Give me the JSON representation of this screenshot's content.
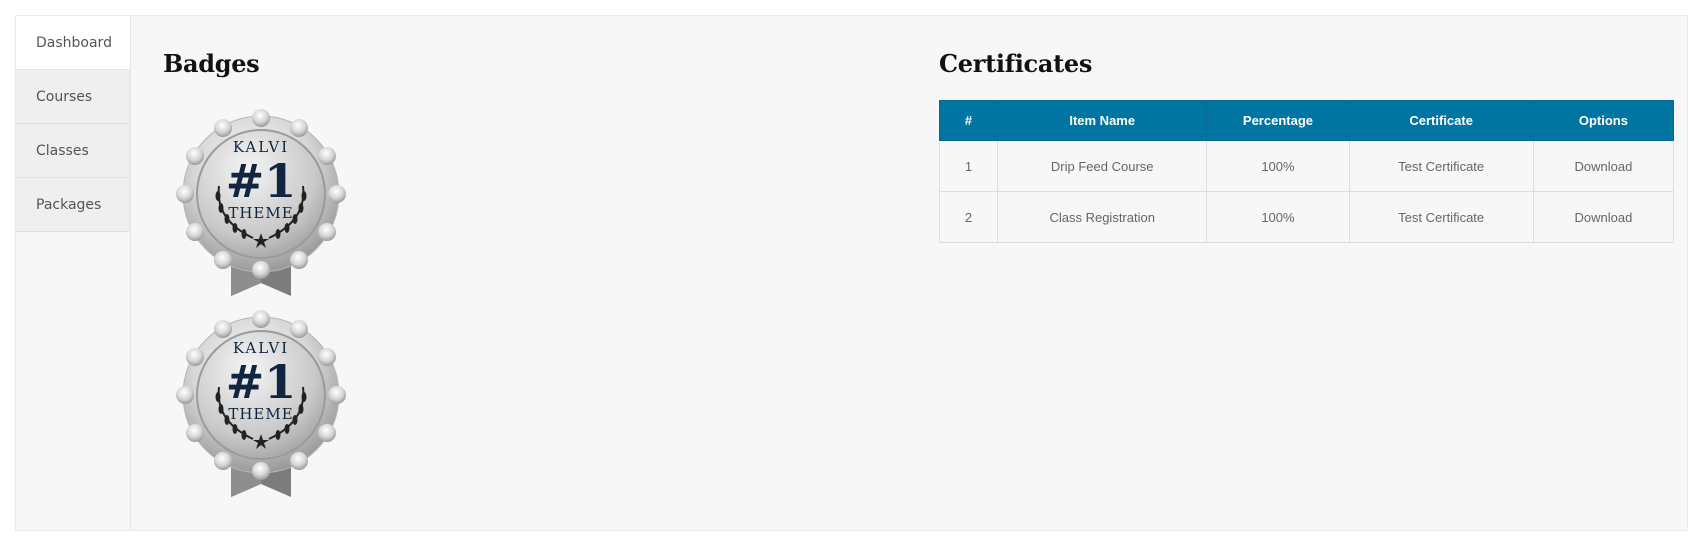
{
  "sidebar": {
    "items": [
      {
        "label": "Dashboard",
        "active": true
      },
      {
        "label": "Courses",
        "active": false
      },
      {
        "label": "Classes",
        "active": false
      },
      {
        "label": "Packages",
        "active": false
      }
    ]
  },
  "badges": {
    "title": "Badges",
    "items": [
      {
        "top_text": "KALVI",
        "number": "#1",
        "bottom_text": "THEME"
      },
      {
        "top_text": "KALVI",
        "number": "#1",
        "bottom_text": "THEME"
      }
    ]
  },
  "certificates": {
    "title": "Certificates",
    "header_color": "#0075a2",
    "columns": [
      "#",
      "Item Name",
      "Percentage",
      "Certificate",
      "Options"
    ],
    "rows": [
      [
        "1",
        "Drip Feed Course",
        "100%",
        "Test Certificate",
        "Download"
      ],
      [
        "2",
        "Class Registration",
        "100%",
        "Test Certificate",
        "Download"
      ]
    ]
  }
}
